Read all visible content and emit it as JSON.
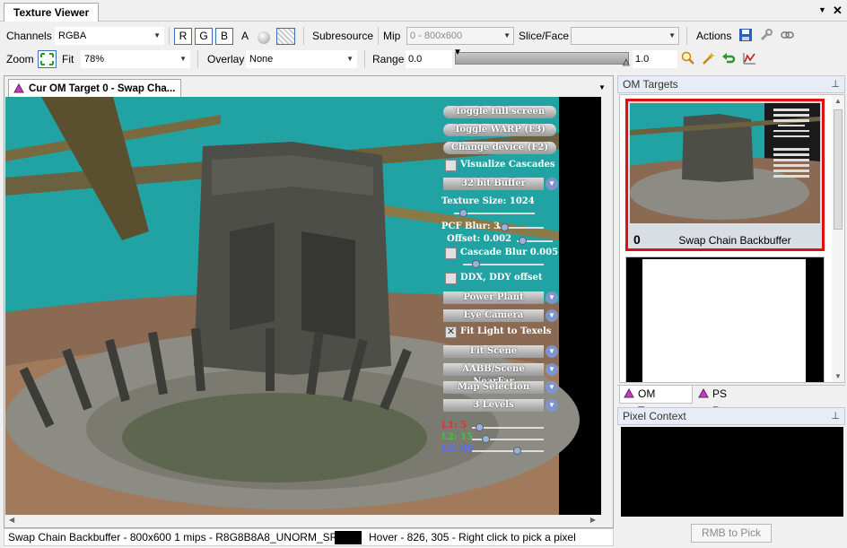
{
  "window": {
    "title": "Texture Viewer",
    "menu_glyph": "▼",
    "close_glyph": "✕"
  },
  "toolbar": {
    "channels_label": "Channels",
    "channels_value": "RGBA",
    "channel_buttons": [
      "R",
      "G",
      "B"
    ],
    "alpha_label": "A",
    "subresource_label": "Subresource",
    "mip_label": "Mip",
    "mip_value": "0 - 800x600",
    "slice_face_label": "Slice/Face",
    "slice_face_value": "",
    "actions_label": "Actions",
    "zoom_label": "Zoom",
    "fit_label": "Fit",
    "zoom_value": "78%",
    "overlay_label": "Overlay",
    "overlay_value": "None",
    "range_label": "Range",
    "range_min": "0.0",
    "range_max": "1.0",
    "icons": [
      "save-icon",
      "wrench-icon",
      "link-icon",
      "zoom-icon",
      "wand-icon",
      "undo-icon",
      "histogram-icon"
    ]
  },
  "document_tab": {
    "label": "Cur OM Target 0 - Swap Cha...",
    "menu_glyph": "▼"
  },
  "viewport_overlay": {
    "buttons": [
      "Toggle full screen",
      "Toggle WARP (F3)",
      "Change device (F2)"
    ],
    "visualize_cascades": "Visualize Cascades",
    "buffer_combo": "32 bit Buffer",
    "texture_size": "Texture Size: 1024",
    "pcf_blur": "PCF Blur: 3",
    "offset": "Offset: 0.002",
    "cascade_blur": "Cascade Blur 0.005",
    "ddx_ddy": "DDX, DDY offset",
    "scene_combo": "Power Plant",
    "camera_combo": "Eye Camera",
    "fit_light": "Fit Light to Texels",
    "fit_scene_combo": "Fit Scene",
    "aabb_combo": "AABB/Scene NearFar",
    "map_selection_combo": "Map Selection",
    "levels_combo": "3 Levels",
    "l1": "L1: 5",
    "l2": "L2: 15",
    "l3": "L3: 60",
    "fit_light_checked": "✕",
    "colors": {
      "l1": "#e03030",
      "l2": "#30d030",
      "l3": "#5070ff"
    }
  },
  "status": {
    "info": "Swap Chain Backbuffer - 800x600 1 mips - R8G8B8A8_UNORM_SRGB",
    "hover": "Hover - 826, 305 - Right click to pick a pixel"
  },
  "om_targets": {
    "header": "OM Targets",
    "pin_glyph": "⊥",
    "items": [
      {
        "index": "0",
        "name": "Swap Chain Backbuffer"
      }
    ]
  },
  "pane_tabs": [
    "OM Targets",
    "PS Resources"
  ],
  "pixel_context": {
    "header": "Pixel Context",
    "rmb_button": "RMB to Pick"
  },
  "colors": {
    "accent": "#3b6fb6",
    "selection": "#dd1111",
    "sky": "#22a8a8"
  }
}
